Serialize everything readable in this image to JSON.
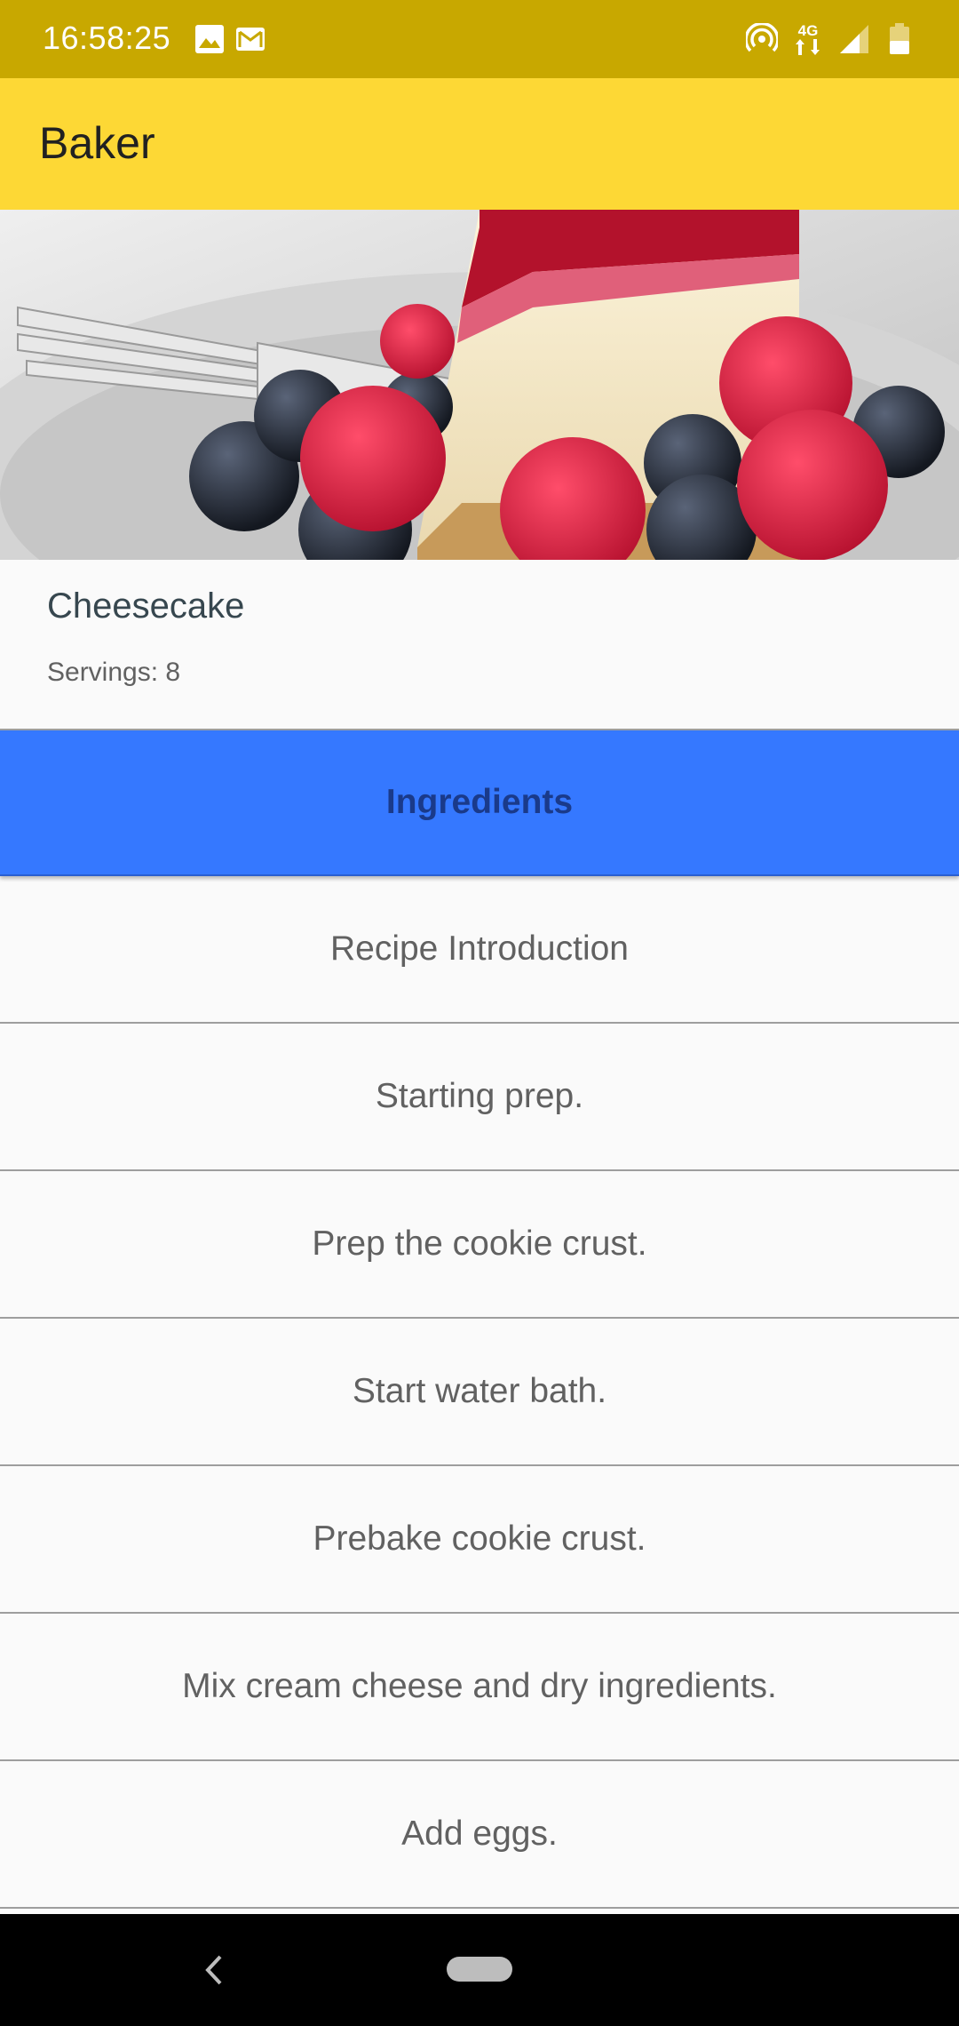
{
  "status_bar": {
    "time": "16:58:25",
    "network_label": "4G",
    "left_icons": [
      "image-icon",
      "gmail-icon"
    ],
    "right_icons": [
      "hotspot-icon",
      "network-4g-icon",
      "signal-icon",
      "battery-icon"
    ]
  },
  "app_bar": {
    "title": "Baker",
    "color": "#fdd835",
    "status_color": "#c8a800"
  },
  "recipe": {
    "name": "Cheesecake",
    "servings": "Servings: 8",
    "image": "cheesecake-with-berries-photo"
  },
  "steps": [
    {
      "label": "Ingredients",
      "selected": true
    },
    {
      "label": "Recipe Introduction",
      "selected": false
    },
    {
      "label": "Starting prep.",
      "selected": false
    },
    {
      "label": "Prep the cookie crust.",
      "selected": false
    },
    {
      "label": "Start water bath.",
      "selected": false
    },
    {
      "label": "Prebake cookie crust.",
      "selected": false
    },
    {
      "label": "Mix cream cheese and dry ingredients.",
      "selected": false
    },
    {
      "label": "Add eggs.",
      "selected": false
    }
  ],
  "selected_color": "#3578ff",
  "nav_bar": {
    "icons": [
      "back-icon",
      "home-pill-icon"
    ]
  }
}
